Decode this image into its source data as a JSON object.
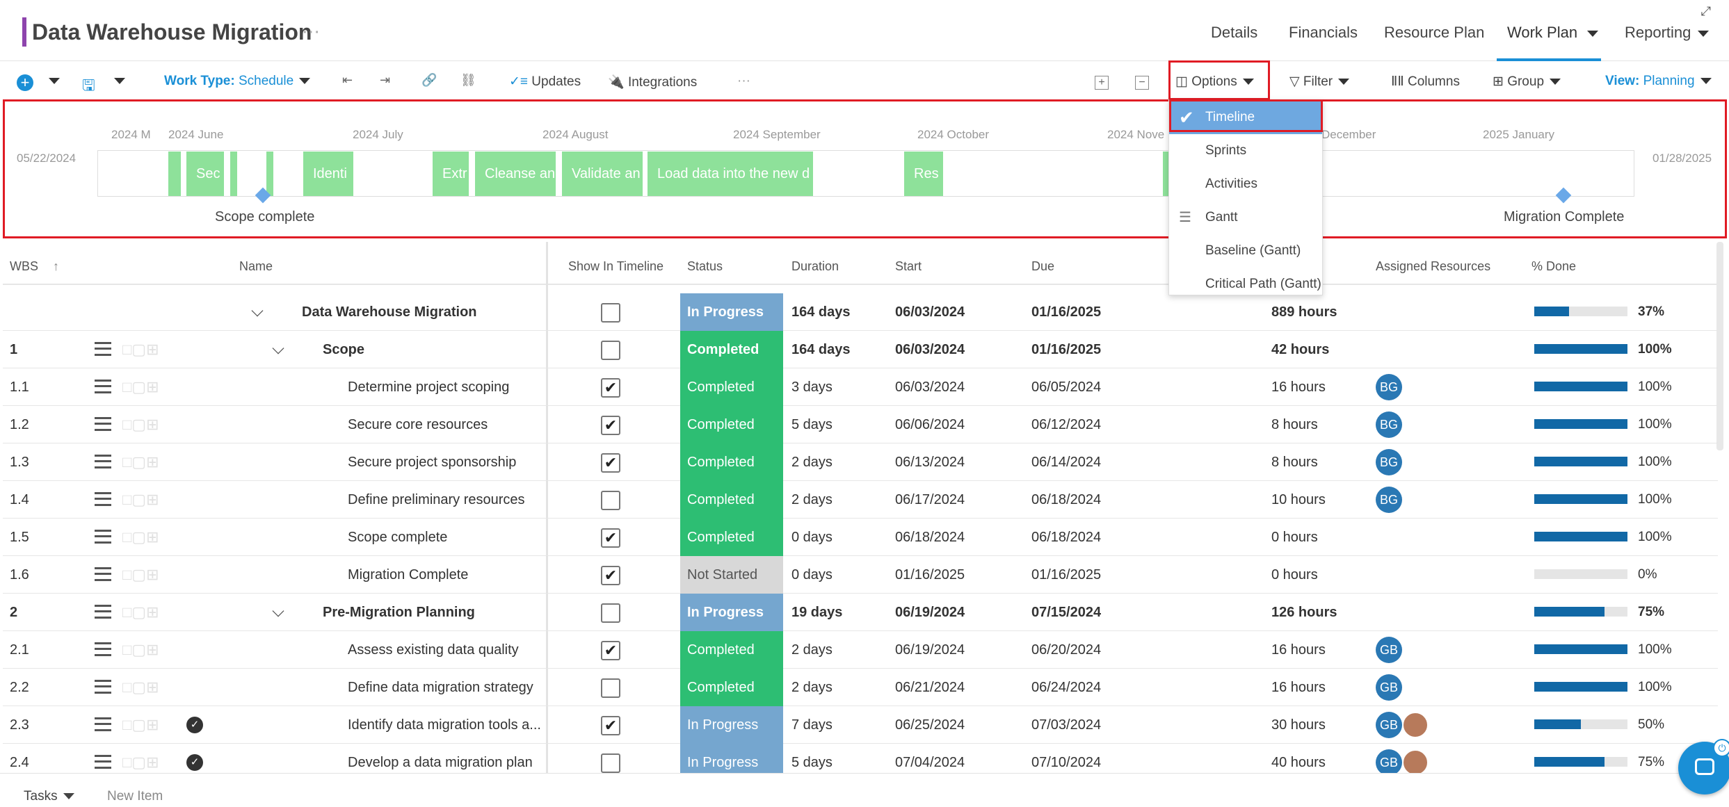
{
  "header": {
    "title": "Data Warehouse Migration",
    "dots": "⋯",
    "nav": [
      "Details",
      "Financials",
      "Resource Plan",
      "Work Plan",
      "Reporting"
    ]
  },
  "toolbar": {
    "work_type_label": "Work Type:",
    "work_type_value": "Schedule",
    "updates": "Updates",
    "integrations": "Integrations",
    "more": "···",
    "options": "Options",
    "filter": "Filter",
    "columns": "Columns",
    "group": "Group",
    "view_label": "View:",
    "view_value": "Planning"
  },
  "options_menu": [
    "Timeline",
    "Sprints",
    "Activities",
    "Gantt",
    "Baseline (Gantt)",
    "Critical Path (Gantt)"
  ],
  "timeline": {
    "start_date": "05/22/2024",
    "end_date": "01/28/2025",
    "months": [
      "2024 M",
      "2024 June",
      "2024 July",
      "2024 August",
      "2024 September",
      "2024 October",
      "2024 Nove",
      "December",
      "2025 January"
    ],
    "bars": [
      "Sec",
      "Identi",
      "Extr",
      "Cleanse an",
      "Validate an",
      "Load data into the new d",
      "Res"
    ],
    "milestones": [
      "Scope complete",
      "Migration Complete"
    ]
  },
  "columns": [
    "WBS",
    "Name",
    "Show In Timeline",
    "Status",
    "Duration",
    "Start",
    "Due",
    "Assigned Resources",
    "% Done"
  ],
  "rows": [
    {
      "wbs": "",
      "name": "Data Warehouse Migration",
      "timeline": false,
      "status": "In Progress",
      "duration": "164 days",
      "start": "06/03/2024",
      "due": "01/16/2025",
      "work": "889 hours",
      "res": "",
      "pct": "37%",
      "p": 37
    },
    {
      "wbs": "1",
      "name": "Scope",
      "timeline": false,
      "status": "Completed",
      "duration": "164 days",
      "start": "06/03/2024",
      "due": "01/16/2025",
      "work": "42 hours",
      "res": "",
      "pct": "100%",
      "p": 100
    },
    {
      "wbs": "1.1",
      "name": "Determine project scoping",
      "timeline": true,
      "status": "Completed",
      "duration": "3 days",
      "start": "06/03/2024",
      "due": "06/05/2024",
      "work": "16 hours",
      "res": "BG",
      "pct": "100%",
      "p": 100
    },
    {
      "wbs": "1.2",
      "name": "Secure core resources",
      "timeline": true,
      "status": "Completed",
      "duration": "5 days",
      "start": "06/06/2024",
      "due": "06/12/2024",
      "work": "8 hours",
      "res": "BG",
      "pct": "100%",
      "p": 100
    },
    {
      "wbs": "1.3",
      "name": "Secure project sponsorship",
      "timeline": true,
      "status": "Completed",
      "duration": "2 days",
      "start": "06/13/2024",
      "due": "06/14/2024",
      "work": "8 hours",
      "res": "BG",
      "pct": "100%",
      "p": 100
    },
    {
      "wbs": "1.4",
      "name": "Define preliminary resources",
      "timeline": false,
      "status": "Completed",
      "duration": "2 days",
      "start": "06/17/2024",
      "due": "06/18/2024",
      "work": "10 hours",
      "res": "BG",
      "pct": "100%",
      "p": 100
    },
    {
      "wbs": "1.5",
      "name": "Scope complete",
      "timeline": true,
      "status": "Completed",
      "duration": "0 days",
      "start": "06/18/2024",
      "due": "06/18/2024",
      "work": "0 hours",
      "res": "",
      "pct": "100%",
      "p": 100
    },
    {
      "wbs": "1.6",
      "name": "Migration Complete",
      "timeline": true,
      "status": "Not Started",
      "duration": "0 days",
      "start": "01/16/2025",
      "due": "01/16/2025",
      "work": "0 hours",
      "res": "",
      "pct": "0%",
      "p": 0
    },
    {
      "wbs": "2",
      "name": "Pre-Migration Planning",
      "timeline": false,
      "status": "In Progress",
      "duration": "19 days",
      "start": "06/19/2024",
      "due": "07/15/2024",
      "work": "126 hours",
      "res": "",
      "pct": "75%",
      "p": 75
    },
    {
      "wbs": "2.1",
      "name": "Assess existing data quality",
      "timeline": true,
      "status": "Completed",
      "duration": "2 days",
      "start": "06/19/2024",
      "due": "06/20/2024",
      "work": "16 hours",
      "res": "GB",
      "pct": "100%",
      "p": 100
    },
    {
      "wbs": "2.2",
      "name": "Define data migration strategy",
      "timeline": false,
      "status": "Completed",
      "duration": "2 days",
      "start": "06/21/2024",
      "due": "06/24/2024",
      "work": "16 hours",
      "res": "GB",
      "pct": "100%",
      "p": 100
    },
    {
      "wbs": "2.3",
      "name": "Identify data migration tools a...",
      "timeline": true,
      "status": "In Progress",
      "duration": "7 days",
      "start": "06/25/2024",
      "due": "07/03/2024",
      "work": "30 hours",
      "res": "GB",
      "pct": "50%",
      "p": 50
    },
    {
      "wbs": "2.4",
      "name": "Develop a data migration plan",
      "timeline": false,
      "status": "In Progress",
      "duration": "5 days",
      "start": "07/04/2024",
      "due": "07/10/2024",
      "work": "40 hours",
      "res": "GB",
      "pct": "75%",
      "p": 75
    }
  ],
  "footer": {
    "tasks": "Tasks",
    "new_item": "New Item"
  }
}
